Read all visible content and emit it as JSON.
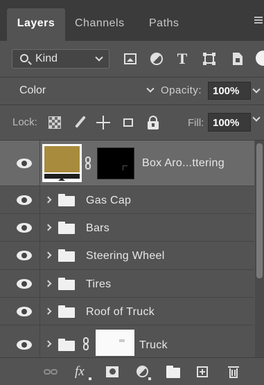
{
  "tabs": [
    {
      "label": "Layers",
      "active": true
    },
    {
      "label": "Channels",
      "active": false
    },
    {
      "label": "Paths",
      "active": false
    }
  ],
  "filter": {
    "kind_label": "Kind",
    "icons": [
      "image-filter-icon",
      "adjustment-filter-icon",
      "type-filter-icon",
      "shape-filter-icon",
      "smart-object-filter-icon"
    ],
    "type_glyph": "T"
  },
  "blend": {
    "mode": "Color",
    "opacity_label": "Opacity:",
    "opacity_value": "100%"
  },
  "lock": {
    "label": "Lock:",
    "fill_label": "Fill:",
    "fill_value": "100%"
  },
  "layers": [
    {
      "name": "Box Aro...ttering",
      "type": "layer-with-mask",
      "selected": true,
      "visible": true,
      "thumbnail_color": "#a98b3d"
    },
    {
      "name": "Gas Cap",
      "type": "group",
      "selected": false,
      "visible": true
    },
    {
      "name": "Bars",
      "type": "group",
      "selected": false,
      "visible": true
    },
    {
      "name": "Steering Wheel",
      "type": "group",
      "selected": false,
      "visible": true
    },
    {
      "name": "Tires",
      "type": "group",
      "selected": false,
      "visible": true
    },
    {
      "name": "Roof of Truck",
      "type": "group",
      "selected": false,
      "visible": true
    },
    {
      "name": "Truck",
      "type": "group-with-mask",
      "selected": false,
      "visible": true
    }
  ],
  "bottom_bar": {
    "fx_label": "fx",
    "icons": [
      "link-layers-icon",
      "layer-style-icon",
      "add-mask-icon",
      "adjustment-layer-icon",
      "new-group-icon",
      "new-layer-icon",
      "delete-layer-icon"
    ]
  },
  "colors": {
    "panel_bg": "#535353",
    "tabbar_bg": "#3b3b3b",
    "selected_row": "#6a6a6a",
    "swatch": "#a98b3d"
  }
}
